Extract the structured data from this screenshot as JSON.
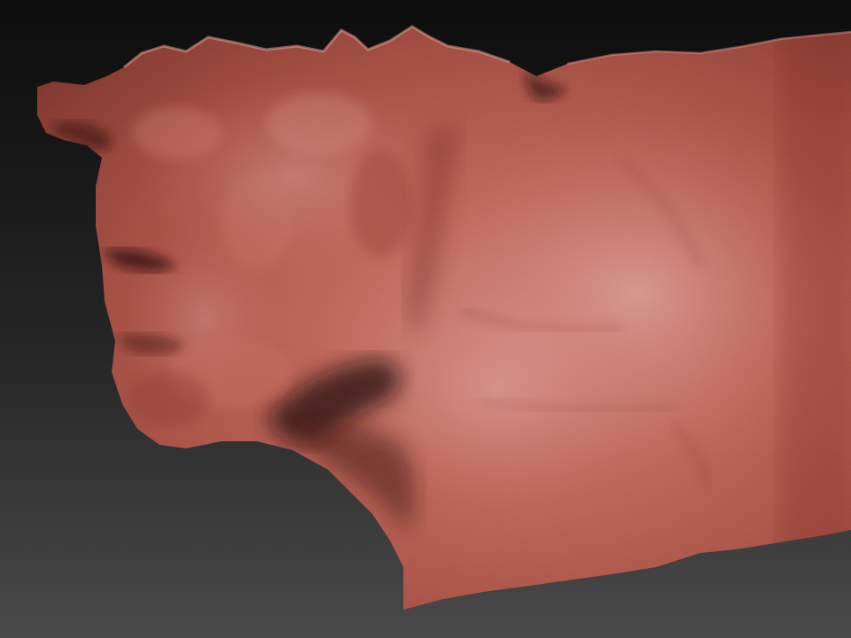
{
  "viewport": {
    "background_colors": [
      "#0d0d0d",
      "#262626",
      "#4a4a4a"
    ]
  },
  "sculpt": {
    "subject": "sculpted-face-scan-mesh",
    "material": "red-wax-matcap",
    "colors": {
      "base": "#a8463a",
      "highlight": "#d98d80",
      "midtone": "#b55a4c",
      "shadow": "#5a1a14",
      "deep_shadow": "#2e0a07"
    }
  }
}
